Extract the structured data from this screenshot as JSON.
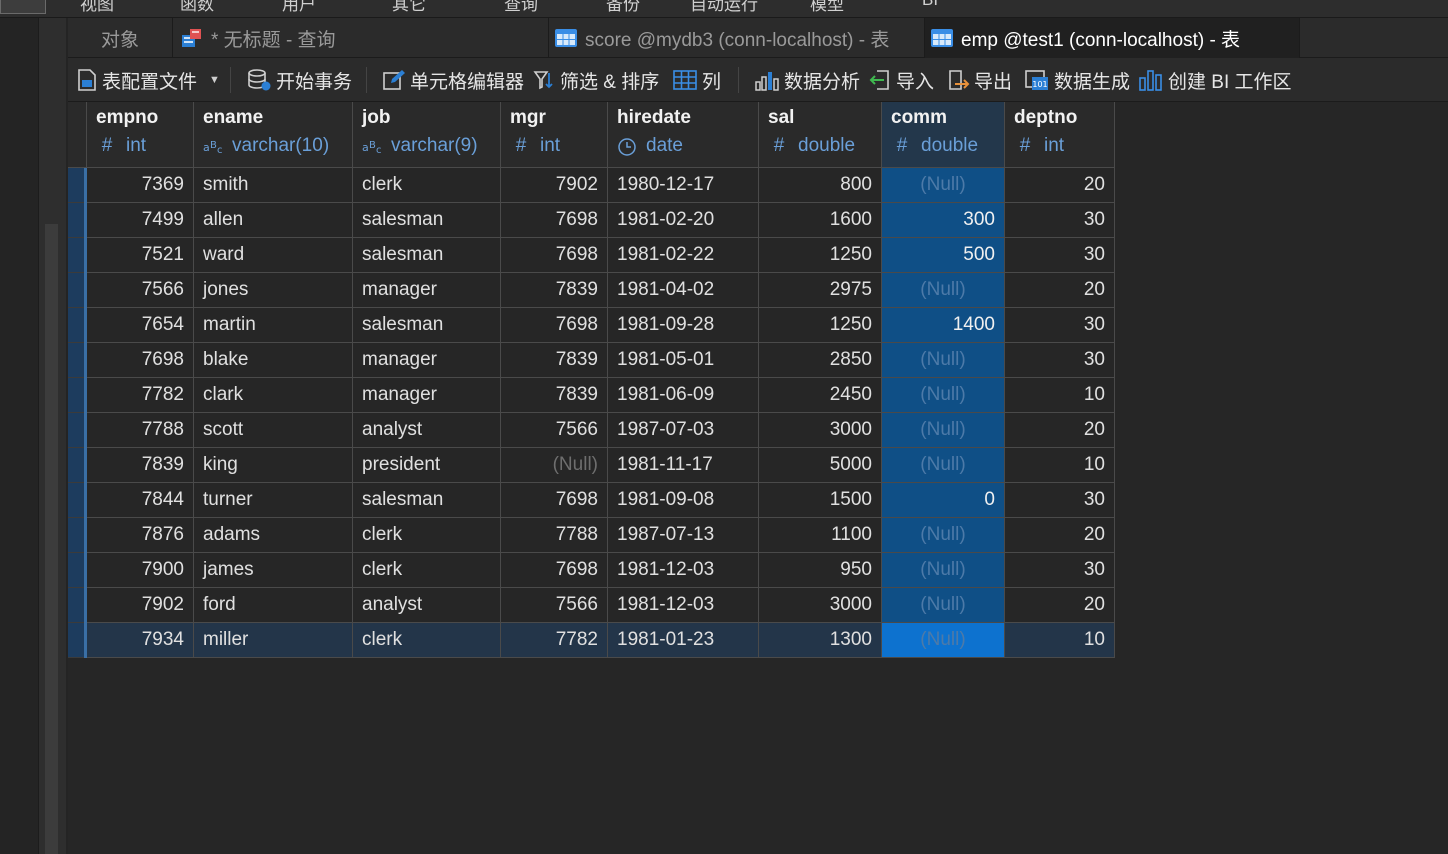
{
  "menu": [
    "视图",
    "函数",
    "用户",
    "其它",
    "查询",
    "备份",
    "自动运行",
    "模型",
    "BI"
  ],
  "tabs": [
    {
      "label": "对象",
      "icon": "none"
    },
    {
      "label": "* 无标题 - 查询",
      "icon": "query-icon"
    },
    {
      "label": "score @mydb3 (conn-localhost) - 表",
      "icon": "table-icon"
    },
    {
      "label": "emp @test1 (conn-localhost) - 表",
      "icon": "table-icon"
    }
  ],
  "active_tab": 3,
  "toolbar": {
    "profile": "表配置文件",
    "begin_tx": "开始事务",
    "cell_editor": "单元格编辑器",
    "filter_sort": "筛选 & 排序",
    "columns": "列",
    "analysis": "数据分析",
    "import": "导入",
    "export": "导出",
    "generate": "数据生成",
    "bi": "创建 BI 工作区"
  },
  "columns": [
    {
      "name": "empno",
      "type": "int",
      "kind": "num"
    },
    {
      "name": "ename",
      "type": "varchar(10)",
      "kind": "str"
    },
    {
      "name": "job",
      "type": "varchar(9)",
      "kind": "str"
    },
    {
      "name": "mgr",
      "type": "int",
      "kind": "num"
    },
    {
      "name": "hiredate",
      "type": "date",
      "kind": "date"
    },
    {
      "name": "sal",
      "type": "double",
      "kind": "num"
    },
    {
      "name": "comm",
      "type": "double",
      "kind": "num"
    },
    {
      "name": "deptno",
      "type": "int",
      "kind": "num"
    }
  ],
  "selected_column": "comm",
  "null_text": "(Null)",
  "rows": [
    [
      "7369",
      "smith",
      "clerk",
      "7902",
      "1980-12-17",
      "800",
      null,
      "20"
    ],
    [
      "7499",
      "allen",
      "salesman",
      "7698",
      "1981-02-20",
      "1600",
      "300",
      "30"
    ],
    [
      "7521",
      "ward",
      "salesman",
      "7698",
      "1981-02-22",
      "1250",
      "500",
      "30"
    ],
    [
      "7566",
      "jones",
      "manager",
      "7839",
      "1981-04-02",
      "2975",
      null,
      "20"
    ],
    [
      "7654",
      "martin",
      "salesman",
      "7698",
      "1981-09-28",
      "1250",
      "1400",
      "30"
    ],
    [
      "7698",
      "blake",
      "manager",
      "7839",
      "1981-05-01",
      "2850",
      null,
      "30"
    ],
    [
      "7782",
      "clark",
      "manager",
      "7839",
      "1981-06-09",
      "2450",
      null,
      "10"
    ],
    [
      "7788",
      "scott",
      "analyst",
      "7566",
      "1987-07-03",
      "3000",
      null,
      "20"
    ],
    [
      "7839",
      "king",
      "president",
      null,
      "1981-11-17",
      "5000",
      null,
      "10"
    ],
    [
      "7844",
      "turner",
      "salesman",
      "7698",
      "1981-09-08",
      "1500",
      "0",
      "30"
    ],
    [
      "7876",
      "adams",
      "clerk",
      "7788",
      "1987-07-13",
      "1100",
      null,
      "20"
    ],
    [
      "7900",
      "james",
      "clerk",
      "7698",
      "1981-12-03",
      "950",
      null,
      "30"
    ],
    [
      "7902",
      "ford",
      "analyst",
      "7566",
      "1981-12-03",
      "3000",
      null,
      "20"
    ],
    [
      "7934",
      "miller",
      "clerk",
      "7782",
      "1981-01-23",
      "1300",
      null,
      "10"
    ]
  ],
  "current_row": 13,
  "colors": {
    "accent": "#0d72cf",
    "selected_column": "#0f4f86",
    "type_text": "#6a9fd8"
  }
}
